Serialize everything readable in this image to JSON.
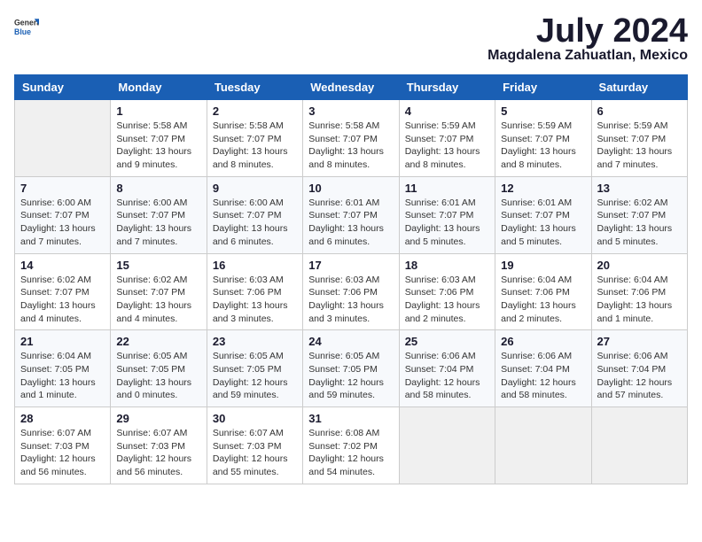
{
  "logo": {
    "general": "General",
    "blue": "Blue"
  },
  "title": "July 2024",
  "location": "Magdalena Zahuatlan, Mexico",
  "days_of_week": [
    "Sunday",
    "Monday",
    "Tuesday",
    "Wednesday",
    "Thursday",
    "Friday",
    "Saturday"
  ],
  "weeks": [
    [
      {
        "day": "",
        "info": ""
      },
      {
        "day": "1",
        "info": "Sunrise: 5:58 AM\nSunset: 7:07 PM\nDaylight: 13 hours\nand 9 minutes."
      },
      {
        "day": "2",
        "info": "Sunrise: 5:58 AM\nSunset: 7:07 PM\nDaylight: 13 hours\nand 8 minutes."
      },
      {
        "day": "3",
        "info": "Sunrise: 5:58 AM\nSunset: 7:07 PM\nDaylight: 13 hours\nand 8 minutes."
      },
      {
        "day": "4",
        "info": "Sunrise: 5:59 AM\nSunset: 7:07 PM\nDaylight: 13 hours\nand 8 minutes."
      },
      {
        "day": "5",
        "info": "Sunrise: 5:59 AM\nSunset: 7:07 PM\nDaylight: 13 hours\nand 8 minutes."
      },
      {
        "day": "6",
        "info": "Sunrise: 5:59 AM\nSunset: 7:07 PM\nDaylight: 13 hours\nand 7 minutes."
      }
    ],
    [
      {
        "day": "7",
        "info": "Sunrise: 6:00 AM\nSunset: 7:07 PM\nDaylight: 13 hours\nand 7 minutes."
      },
      {
        "day": "8",
        "info": "Sunrise: 6:00 AM\nSunset: 7:07 PM\nDaylight: 13 hours\nand 7 minutes."
      },
      {
        "day": "9",
        "info": "Sunrise: 6:00 AM\nSunset: 7:07 PM\nDaylight: 13 hours\nand 6 minutes."
      },
      {
        "day": "10",
        "info": "Sunrise: 6:01 AM\nSunset: 7:07 PM\nDaylight: 13 hours\nand 6 minutes."
      },
      {
        "day": "11",
        "info": "Sunrise: 6:01 AM\nSunset: 7:07 PM\nDaylight: 13 hours\nand 5 minutes."
      },
      {
        "day": "12",
        "info": "Sunrise: 6:01 AM\nSunset: 7:07 PM\nDaylight: 13 hours\nand 5 minutes."
      },
      {
        "day": "13",
        "info": "Sunrise: 6:02 AM\nSunset: 7:07 PM\nDaylight: 13 hours\nand 5 minutes."
      }
    ],
    [
      {
        "day": "14",
        "info": "Sunrise: 6:02 AM\nSunset: 7:07 PM\nDaylight: 13 hours\nand 4 minutes."
      },
      {
        "day": "15",
        "info": "Sunrise: 6:02 AM\nSunset: 7:07 PM\nDaylight: 13 hours\nand 4 minutes."
      },
      {
        "day": "16",
        "info": "Sunrise: 6:03 AM\nSunset: 7:06 PM\nDaylight: 13 hours\nand 3 minutes."
      },
      {
        "day": "17",
        "info": "Sunrise: 6:03 AM\nSunset: 7:06 PM\nDaylight: 13 hours\nand 3 minutes."
      },
      {
        "day": "18",
        "info": "Sunrise: 6:03 AM\nSunset: 7:06 PM\nDaylight: 13 hours\nand 2 minutes."
      },
      {
        "day": "19",
        "info": "Sunrise: 6:04 AM\nSunset: 7:06 PM\nDaylight: 13 hours\nand 2 minutes."
      },
      {
        "day": "20",
        "info": "Sunrise: 6:04 AM\nSunset: 7:06 PM\nDaylight: 13 hours\nand 1 minute."
      }
    ],
    [
      {
        "day": "21",
        "info": "Sunrise: 6:04 AM\nSunset: 7:05 PM\nDaylight: 13 hours\nand 1 minute."
      },
      {
        "day": "22",
        "info": "Sunrise: 6:05 AM\nSunset: 7:05 PM\nDaylight: 13 hours\nand 0 minutes."
      },
      {
        "day": "23",
        "info": "Sunrise: 6:05 AM\nSunset: 7:05 PM\nDaylight: 12 hours\nand 59 minutes."
      },
      {
        "day": "24",
        "info": "Sunrise: 6:05 AM\nSunset: 7:05 PM\nDaylight: 12 hours\nand 59 minutes."
      },
      {
        "day": "25",
        "info": "Sunrise: 6:06 AM\nSunset: 7:04 PM\nDaylight: 12 hours\nand 58 minutes."
      },
      {
        "day": "26",
        "info": "Sunrise: 6:06 AM\nSunset: 7:04 PM\nDaylight: 12 hours\nand 58 minutes."
      },
      {
        "day": "27",
        "info": "Sunrise: 6:06 AM\nSunset: 7:04 PM\nDaylight: 12 hours\nand 57 minutes."
      }
    ],
    [
      {
        "day": "28",
        "info": "Sunrise: 6:07 AM\nSunset: 7:03 PM\nDaylight: 12 hours\nand 56 minutes."
      },
      {
        "day": "29",
        "info": "Sunrise: 6:07 AM\nSunset: 7:03 PM\nDaylight: 12 hours\nand 56 minutes."
      },
      {
        "day": "30",
        "info": "Sunrise: 6:07 AM\nSunset: 7:03 PM\nDaylight: 12 hours\nand 55 minutes."
      },
      {
        "day": "31",
        "info": "Sunrise: 6:08 AM\nSunset: 7:02 PM\nDaylight: 12 hours\nand 54 minutes."
      },
      {
        "day": "",
        "info": ""
      },
      {
        "day": "",
        "info": ""
      },
      {
        "day": "",
        "info": ""
      }
    ]
  ]
}
